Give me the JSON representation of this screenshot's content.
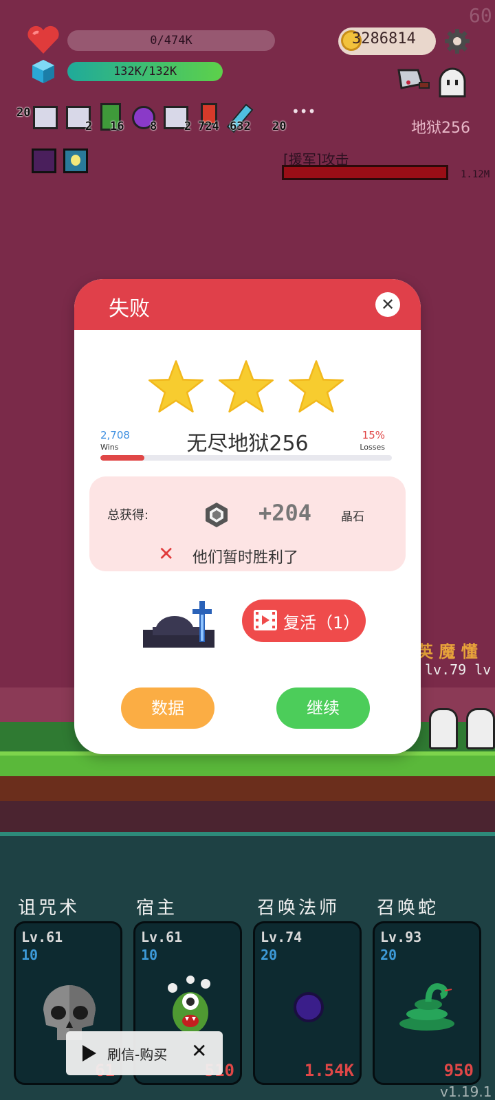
{
  "hud": {
    "fps": "60",
    "hp_text": "0/474K",
    "hp_fraction": 0.0,
    "shield_text": "132K/132K",
    "shield_fraction": 1.0,
    "coins": "3286814",
    "stage": "地狱256",
    "items": [
      {
        "icon": "scroll-icon",
        "count": "20"
      },
      {
        "icon": "scroll-icon",
        "count": "2"
      },
      {
        "icon": "green-book-icon",
        "count": "16"
      },
      {
        "icon": "potion-icon",
        "count": "8"
      },
      {
        "icon": "scroll-icon",
        "count": "2"
      },
      {
        "icon": "boot-icon",
        "count": "724"
      },
      {
        "icon": "sword-icon",
        "count": "632"
      },
      {
        "icon": "more-icon",
        "count": "20"
      }
    ],
    "more_symbol": "•••",
    "enemy_label": "[援军]攻击",
    "enemy_hp": "1.12M"
  },
  "modal": {
    "title": "失败",
    "close_symbol": "✕",
    "stars": 3,
    "wins_value": "2,708",
    "wins_label": "Wins",
    "losses_value": "15%",
    "losses_label": "Losses",
    "level_name": "无尽地狱256",
    "progress_fraction": 0.15,
    "reward_label": "总获得:",
    "reward_amount": "+204",
    "reward_unit": "晶石",
    "fail_symbol": "✕",
    "fail_message": "他们暂时胜利了",
    "revive_label": "复活（1）",
    "data_button": "数据",
    "continue_button": "继续"
  },
  "battle": {
    "enemy_names": "英 魔 懂",
    "enemy_levels": "lv.79  lv"
  },
  "skills": [
    {
      "name": "诅咒术",
      "level": "Lv.61",
      "count": "10",
      "cost": "61",
      "icon": "skull-icon"
    },
    {
      "name": "宿主",
      "level": "Lv.61",
      "count": "10",
      "cost": "510",
      "icon": "green-monster-icon"
    },
    {
      "name": "召唤法师",
      "level": "Lv.74",
      "count": "20",
      "cost": "1.54K",
      "icon": "dark-orb-icon"
    },
    {
      "name": "召唤蛇",
      "level": "Lv.93",
      "count": "20",
      "cost": "950",
      "icon": "snake-icon"
    }
  ],
  "ad_banner": {
    "label": "刷信-购买",
    "close_symbol": "✕"
  },
  "version": "v1.19.1"
}
